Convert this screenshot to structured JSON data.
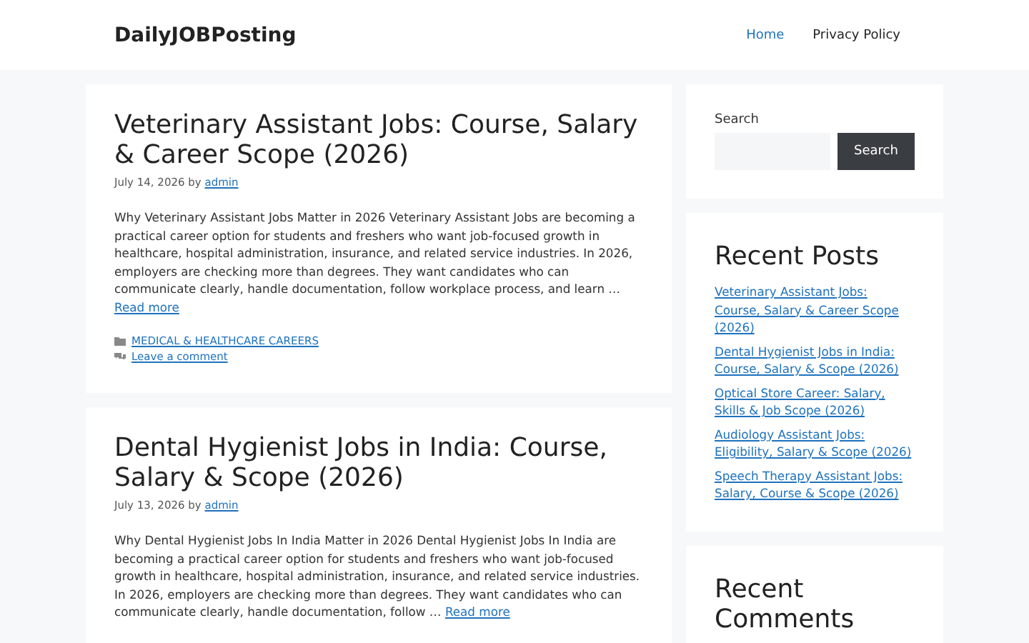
{
  "site": {
    "title": "DailyJOBPosting"
  },
  "nav": [
    {
      "label": "Home",
      "selected": true
    },
    {
      "label": "Privacy Policy",
      "selected": false
    }
  ],
  "posts": [
    {
      "title": "Veterinary Assistant Jobs: Course, Salary & Career Scope (2026)",
      "date": "July 14, 2026",
      "by": "by",
      "author": "admin",
      "excerpt": "Why Veterinary Assistant Jobs Matter in 2026 Veterinary Assistant Jobs are becoming a practical career option for students and freshers who want job-focused growth in healthcare, hospital administration, insurance, and related service industries. In 2026, employers are checking more than degrees. They want candidates who can communicate clearly, handle documentation, follow workplace process, and learn …",
      "read_more": "Read more",
      "category": "MEDICAL & HEALTHCARE CAREERS",
      "comment": "Leave a comment"
    },
    {
      "title": "Dental Hygienist Jobs in India: Course, Salary & Scope (2026)",
      "date": "July 13, 2026",
      "by": "by",
      "author": "admin",
      "excerpt": "Why Dental Hygienist Jobs In India Matter in 2026 Dental Hygienist Jobs In India are becoming a practical career option for students and freshers who want job-focused growth in healthcare, hospital administration, insurance, and related service industries. In 2026, employers are checking more than degrees. They want candidates who can communicate clearly, handle documentation, follow …",
      "read_more": "Read more"
    }
  ],
  "search": {
    "label": "Search",
    "button": "Search"
  },
  "recent_posts": {
    "title": "Recent Posts",
    "items": [
      "Veterinary Assistant Jobs: Course, Salary & Career Scope (2026)",
      "Dental Hygienist Jobs in India: Course, Salary & Scope (2026)",
      "Optical Store Career: Salary, Skills & Job Scope (2026)",
      "Audiology Assistant Jobs: Eligibility, Salary & Scope (2026)",
      "Speech Therapy Assistant Jobs: Salary, Course & Scope (2026)"
    ]
  },
  "recent_comments": {
    "title": "Recent Comments"
  }
}
